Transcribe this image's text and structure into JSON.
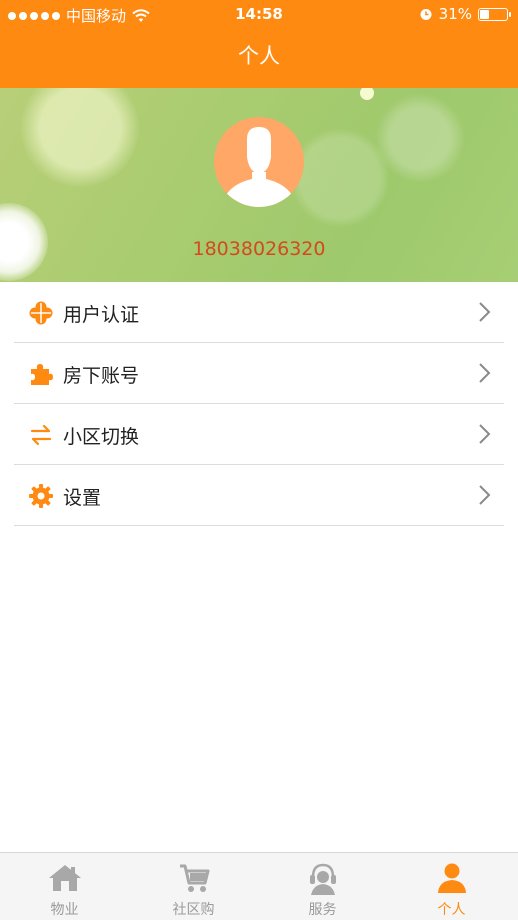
{
  "status_bar": {
    "carrier": "中国移动",
    "time": "14:58",
    "battery": "31%",
    "battery_level": 0.31
  },
  "nav": {
    "title": "个人"
  },
  "profile": {
    "phone": "18038026320"
  },
  "menu": {
    "items": [
      {
        "label": "用户认证",
        "icon": "clover-icon"
      },
      {
        "label": "房下账号",
        "icon": "puzzle-icon"
      },
      {
        "label": "小区切换",
        "icon": "swap-arrows-icon"
      },
      {
        "label": "设置",
        "icon": "gear-icon"
      }
    ]
  },
  "tabbar": {
    "tabs": [
      {
        "label": "物业",
        "icon": "house-icon",
        "active": false
      },
      {
        "label": "社区购",
        "icon": "cart-icon",
        "active": false
      },
      {
        "label": "服务",
        "icon": "headset-icon",
        "active": false
      },
      {
        "label": "个人",
        "icon": "person-icon",
        "active": true
      }
    ]
  },
  "colors": {
    "accent": "#ff8a12",
    "phone_text": "#d24a1e",
    "tab_inactive": "#9a9a9a"
  }
}
